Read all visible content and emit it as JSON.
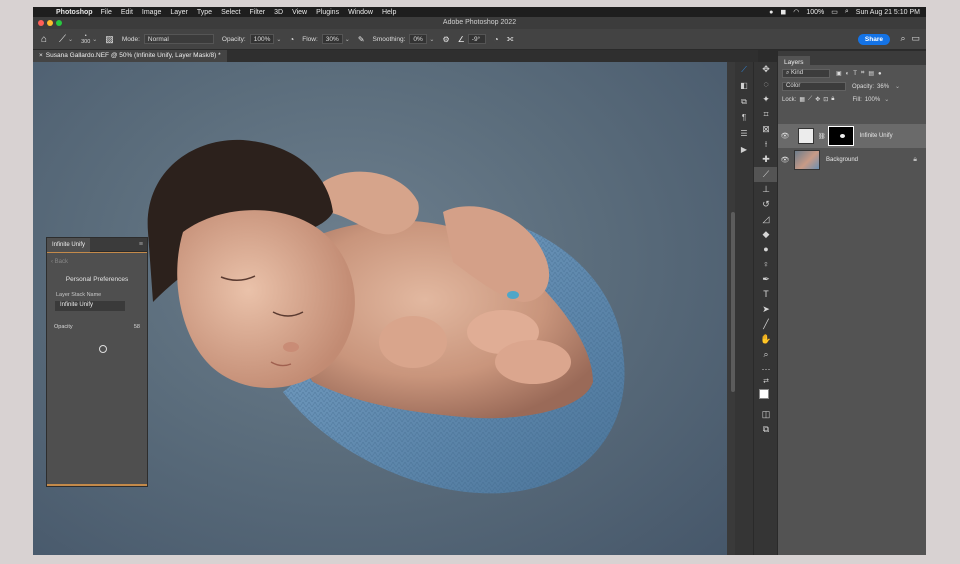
{
  "menubar": {
    "app_name": "Photoshop",
    "items": [
      "File",
      "Edit",
      "Image",
      "Layer",
      "Type",
      "Select",
      "Filter",
      "3D",
      "View",
      "Plugins",
      "Window",
      "Help"
    ],
    "battery": "100%",
    "clock": "Sun Aug 21  5:10 PM"
  },
  "window": {
    "title": "Adobe Photoshop 2022"
  },
  "options": {
    "brush_size": "300",
    "mode_label": "Mode:",
    "mode_value": "Normal",
    "opacity_label": "Opacity:",
    "opacity_value": "100%",
    "flow_label": "Flow:",
    "flow_value": "30%",
    "smoothing_label": "Smoothing:",
    "smoothing_value": "0%",
    "angle_value": "-9°",
    "share_label": "Share"
  },
  "document": {
    "tab_title": "Susana Gallardo.NEF @ 50% (Infinite Unify, Layer Mask/8) *"
  },
  "plugin_panel": {
    "tab_label": "Infinite Unify",
    "back_label": "‹ Back",
    "section_title": "Personal Preferences",
    "field_label": "Layer Stack Name",
    "field_value": "Infinite Unify",
    "opacity_label": "Opacity",
    "opacity_value": "58"
  },
  "layers_panel": {
    "tab_label": "Layers",
    "filter_kind": "Kind",
    "blend_mode": "Color",
    "opacity_label": "Opacity:",
    "opacity_value": "36%",
    "lock_label": "Lock:",
    "fill_label": "Fill:",
    "fill_value": "100%",
    "layers": [
      {
        "name": "Infinite Unify"
      },
      {
        "name": "Background"
      }
    ]
  },
  "colors": {
    "accent": "#1473e6",
    "panel_accent": "#c48a4a",
    "canvas_bg": "#5b6d7c"
  }
}
